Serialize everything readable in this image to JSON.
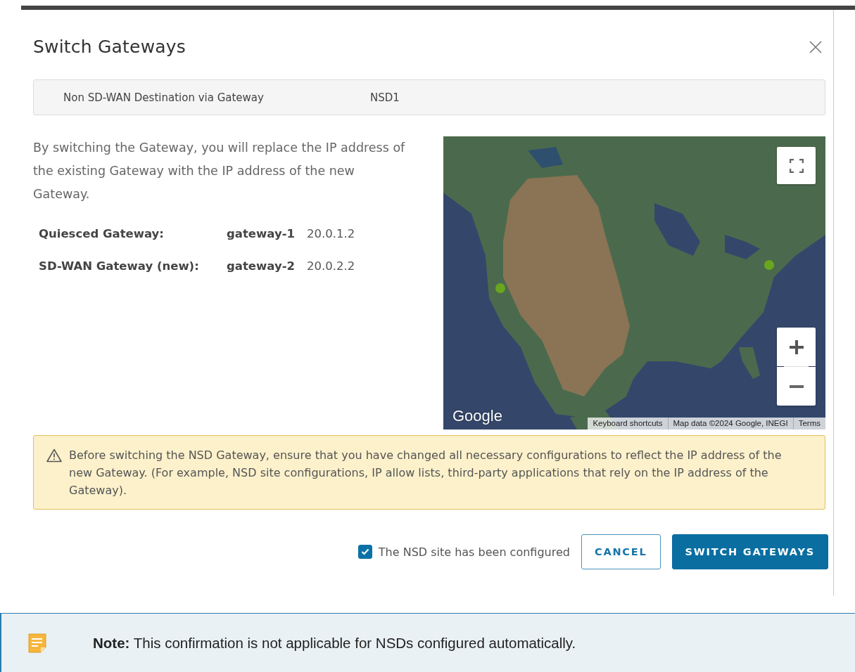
{
  "dialog": {
    "title": "Switch Gateways",
    "info_bar": {
      "label": "Non SD-WAN Destination via Gateway",
      "value": "NSD1"
    },
    "description": "By switching the Gateway, you will replace the IP address of the existing Gateway with the IP address of the new Gateway.",
    "gateways": [
      {
        "label": "Quiesced Gateway:",
        "name": "gateway-1",
        "ip": "20.0.1.2"
      },
      {
        "label": "SD-WAN Gateway (new):",
        "name": "gateway-2",
        "ip": "20.0.2.2"
      }
    ],
    "map": {
      "kind": "picture",
      "logo": "Google",
      "attribution": [
        "Keyboard shortcuts",
        "Map data ©2024 Google, INEGI",
        "Terms"
      ]
    },
    "warning": "Before switching the NSD Gateway, ensure that you have changed all necessary configurations to reflect the IP address of the new Gateway. (For example, NSD site configurations, IP allow lists, third-party applications that rely on the IP address of the Gateway).",
    "confirm": {
      "label": "The NSD site has been configured",
      "checked": true
    },
    "buttons": [
      {
        "label": "CANCEL",
        "kind": "secondary"
      },
      {
        "label": "SWITCH GATEWAYS",
        "kind": "primary"
      }
    ]
  },
  "note": {
    "text": "**Note:**  This confirmation is not applicable for NSDs configured automatically."
  }
}
